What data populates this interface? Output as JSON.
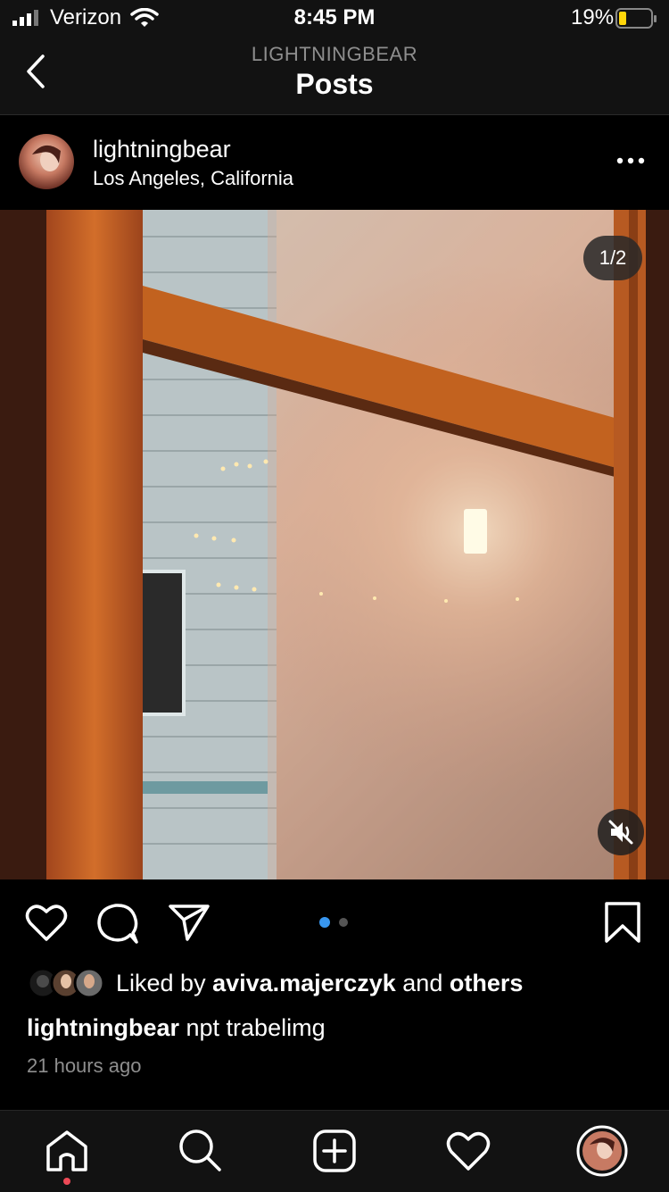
{
  "status_bar": {
    "carrier": "Verizon",
    "time": "8:45 PM",
    "battery": "19%"
  },
  "nav": {
    "username": "LIGHTNINGBEAR",
    "title": "Posts",
    "back_icon": "chevron-left-icon"
  },
  "post": {
    "username": "lightningbear",
    "location": "Los Angeles, California",
    "menu_icon": "more-horizontal-icon",
    "media_counter": "1/2",
    "mute_icon": "speaker-muted-icon",
    "liked_by_prefix": "Liked by",
    "liked_by_user": "aviva.majerczyk",
    "liked_by_and": "and",
    "liked_by_others": "others",
    "caption_user": "lightningbear",
    "caption_text": "npt trabelimg",
    "time_ago": "21 hours ago"
  },
  "tabbar": {
    "items": [
      "home-icon",
      "search-icon",
      "new-post-icon",
      "activity-heart-icon",
      "profile-avatar"
    ]
  },
  "colors": {
    "background": "#000000",
    "secondary_text": "#8e8e8e",
    "accent_dot": "#3897f0",
    "battery_low": "#ffd60a",
    "notification_dot": "#ed4956"
  }
}
